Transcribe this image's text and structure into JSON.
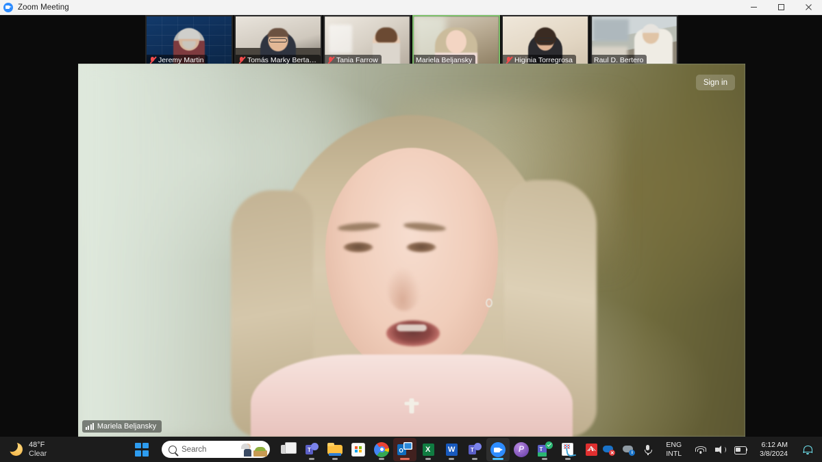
{
  "window": {
    "title": "Zoom Meeting",
    "app_icon": "zoom-icon",
    "controls": {
      "minimize": "minimize-icon",
      "maximize": "maximize-icon",
      "close": "close-icon"
    }
  },
  "meeting": {
    "sign_in_label": "Sign in",
    "active_speaker": {
      "name": "Mariela Beljansky",
      "audio_icon": "audio-level-bars-icon"
    },
    "participants": [
      {
        "name": "Jeremy Martin",
        "muted": true,
        "active": false,
        "bg": "jeremy"
      },
      {
        "name": "Tomás Marky Bertarelli",
        "muted": true,
        "active": false,
        "bg": "tomas"
      },
      {
        "name": "Tania Farrow",
        "muted": true,
        "active": false,
        "bg": "tania"
      },
      {
        "name": "Mariela Beljansky",
        "muted": false,
        "active": true,
        "bg": "mariela"
      },
      {
        "name": "Higinia Torregrosa",
        "muted": true,
        "active": false,
        "bg": "higinia"
      },
      {
        "name": "Raul D. Bertero",
        "muted": false,
        "active": false,
        "bg": "raul"
      }
    ]
  },
  "taskbar": {
    "weather": {
      "temperature": "48°F",
      "condition": "Clear",
      "icon": "moon-icon"
    },
    "start_label": "Start",
    "search": {
      "placeholder": "Search",
      "icon": "search-icon"
    },
    "apps": [
      {
        "name": "task-view",
        "label": "Task View",
        "state": "idle"
      },
      {
        "name": "microsoft-teams",
        "label": "Microsoft Teams",
        "state": "running"
      },
      {
        "name": "file-explorer",
        "label": "File Explorer",
        "state": "running"
      },
      {
        "name": "microsoft-store",
        "label": "Microsoft Store",
        "state": "idle"
      },
      {
        "name": "google-chrome",
        "label": "Google Chrome",
        "state": "running"
      },
      {
        "name": "microsoft-outlook",
        "label": "Microsoft Outlook",
        "state": "selected"
      },
      {
        "name": "microsoft-excel",
        "label": "Microsoft Excel",
        "state": "running"
      },
      {
        "name": "microsoft-word",
        "label": "Microsoft Word",
        "state": "running"
      },
      {
        "name": "teams-chat",
        "label": "Teams Chat",
        "state": "running"
      },
      {
        "name": "zoom",
        "label": "Zoom",
        "state": "active"
      },
      {
        "name": "paint-app",
        "label": "Paint",
        "state": "idle"
      },
      {
        "name": "teams-live",
        "label": "Teams Live",
        "state": "running"
      },
      {
        "name": "snipping-tool",
        "label": "Snipping Tool",
        "state": "running"
      },
      {
        "name": "adobe-acrobat",
        "label": "Adobe Acrobat Reader",
        "state": "idle"
      }
    ],
    "tray": {
      "overflow_icon": "chevron-up-icon",
      "onedrive_error_icon": "cloud-error-icon",
      "onedrive_sync_icon": "cloud-sync-icon",
      "microphone_icon": "microphone-icon",
      "language": {
        "line1": "ENG",
        "line2": "INTL"
      },
      "network_icon": "wifi-icon",
      "volume_icon": "speaker-icon",
      "battery_icon": "battery-icon",
      "clock": {
        "time": "6:12 AM",
        "date": "3/8/2024"
      },
      "notifications_icon": "bell-icon"
    }
  },
  "colors": {
    "accent_blue": "#2d8cff",
    "active_speaker_green": "#7dbf6a",
    "muted_red": "#f24d4d",
    "taskbar_bg": "#1c1c1c",
    "titlebar_bg": "#f3f3f3",
    "notification_cyan": "#6fe3ef"
  }
}
